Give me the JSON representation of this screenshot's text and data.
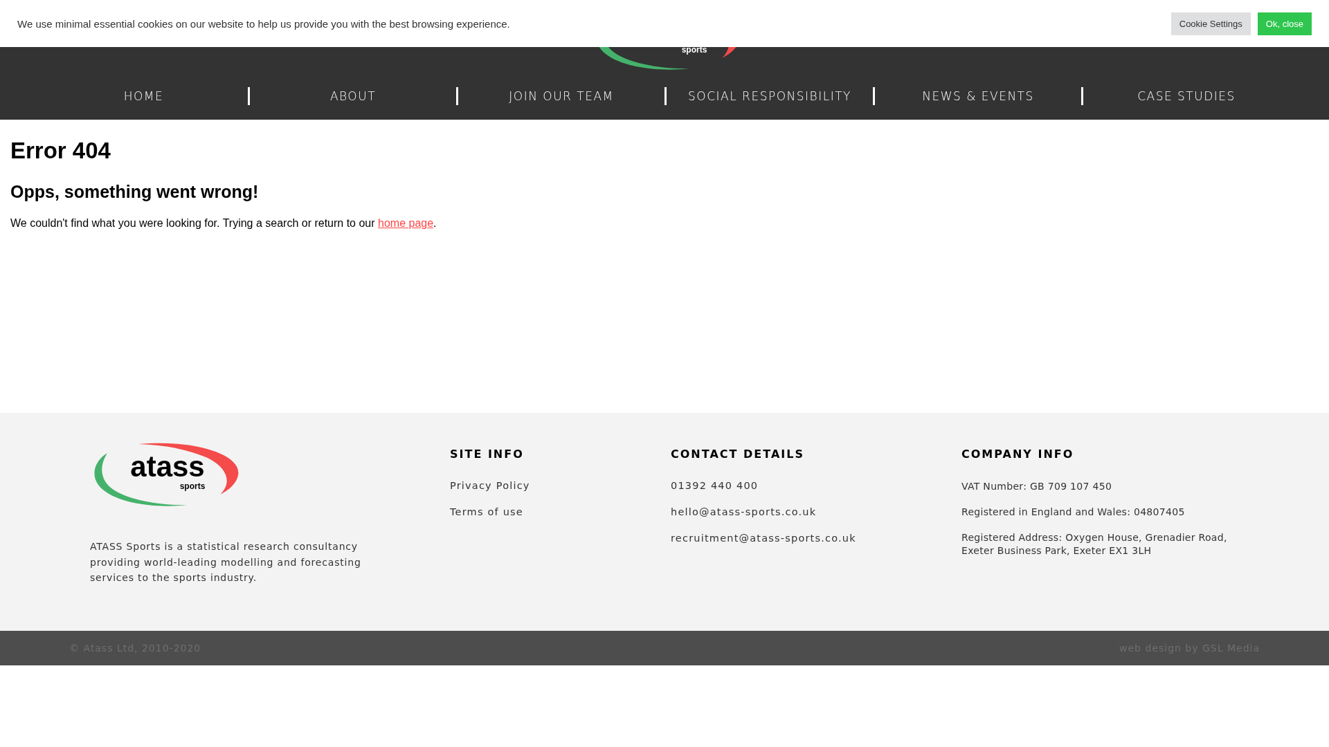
{
  "cookie_bar": {
    "message": "We use minimal essential cookies on our website to help us provide you with the best browsing experience.",
    "buttons": [
      {
        "label": "Cookie Settings",
        "kind": "secondary"
      },
      {
        "label": "Ok, close",
        "kind": "primary"
      }
    ]
  },
  "header": {
    "logo_subtitle": "sports"
  },
  "nav": [
    {
      "label": "HOME"
    },
    {
      "label": "ABOUT"
    },
    {
      "label": "JOIN OUR TEAM"
    },
    {
      "label": "SOCIAL RESPONSIBILITY"
    },
    {
      "label": "NEWS & EVENTS"
    },
    {
      "label": "CASE STUDIES"
    }
  ],
  "main": {
    "title": "Error 404",
    "subtitle": "Opps, something went wrong!",
    "text": "We couldn't find what you were looking for. Trying a search or return to our ",
    "link": "home page",
    "text_end": "."
  },
  "footer": {
    "logo": {
      "name": "atass",
      "subtitle": "sports"
    },
    "description": "ATASS Sports is a statistical research consultancy providing world-leading modelling and forecasting services to the sports industry.",
    "columns": [
      {
        "heading": "SITE INFO",
        "kind": "links",
        "items": [
          "Privacy Policy",
          "Terms of use"
        ]
      },
      {
        "heading": "CONTACT DETAILS",
        "kind": "links",
        "items": [
          "01392 440 400",
          "hello@atass-sports.co.uk",
          "recruitment@atass-sports.co.uk"
        ]
      },
      {
        "heading": "COMPANY INFO",
        "kind": "info",
        "items": [
          "VAT Number: GB 709 107 450",
          "Registered in England and Wales: 04807405",
          "Registered Address: Oxygen House, Grenadier Road, Exeter Business Park, Exeter EX1 3LH"
        ]
      }
    ]
  },
  "bottom_bar": {
    "copyright": "© Atass Ltd, 2010-2020",
    "credit": "web design by GSL Media"
  }
}
